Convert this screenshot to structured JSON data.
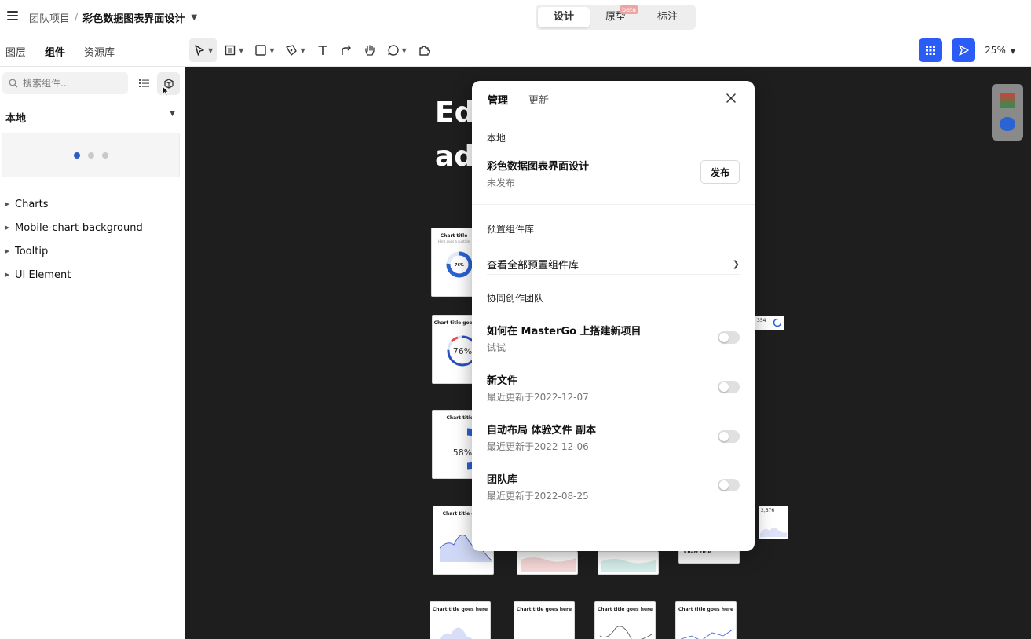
{
  "header": {
    "team": "团队项目",
    "separator": "/",
    "file_name": "彩色数据图表界面设计",
    "modes": [
      {
        "label": "设计",
        "active": true
      },
      {
        "label": "原型",
        "badge": "beta",
        "active": false
      },
      {
        "label": "标注",
        "active": false
      }
    ]
  },
  "toolbar": {
    "panel_tabs": [
      {
        "label": "图层",
        "active": false
      },
      {
        "label": "组件",
        "active": true
      },
      {
        "label": "资源库",
        "active": false
      }
    ],
    "zoom": "25%"
  },
  "sidebar": {
    "search_placeholder": "搜索组件...",
    "local_label": "本地",
    "groups": [
      "Charts",
      "Mobile-chart-background",
      "Tooltip",
      "UI Element"
    ]
  },
  "canvas": {
    "big_text_lines": [
      "Ed",
      "ad"
    ],
    "thumbs": [
      {
        "title": "Chart title",
        "value": "76%"
      },
      {
        "title": "Chart title goes",
        "value": "76%"
      },
      {
        "title": "Chart title",
        "value": "58%"
      },
      {
        "title": "Chart title goes"
      },
      {
        "title": "Chart title"
      },
      {
        "title": "Chart title goes here"
      },
      {
        "title": "Chart title goes here"
      },
      {
        "title": "Chart title goes here"
      },
      {
        "title": "Chart title goes here"
      }
    ],
    "mini_cards": [
      {
        "value": "354"
      },
      {
        "value": "2,676"
      }
    ]
  },
  "modal": {
    "tabs": [
      {
        "label": "管理",
        "active": true
      },
      {
        "label": "更新",
        "active": false
      }
    ],
    "local_label": "本地",
    "local_file": {
      "title": "彩色数据图表界面设计",
      "status": "未发布"
    },
    "publish_label": "发布",
    "preset_label": "预置组件库",
    "preset_link": "查看全部预置组件库",
    "team_label": "协同创作团队",
    "team_libraries": [
      {
        "title": "如何在 MasterGo 上搭建新项目",
        "sub": "试试",
        "enabled": false
      },
      {
        "title": "新文件",
        "sub": "最近更新于2022-12-07",
        "enabled": false
      },
      {
        "title": "自动布局 体验文件 副本",
        "sub": "最近更新于2022-12-06",
        "enabled": false
      },
      {
        "title": "团队库",
        "sub": "最近更新于2022-08-25",
        "enabled": false
      }
    ]
  },
  "colors": {
    "accent": "#2b5cf6",
    "canvas_bg": "#1e1e1e",
    "toggle_off": "#e0e0e0"
  }
}
